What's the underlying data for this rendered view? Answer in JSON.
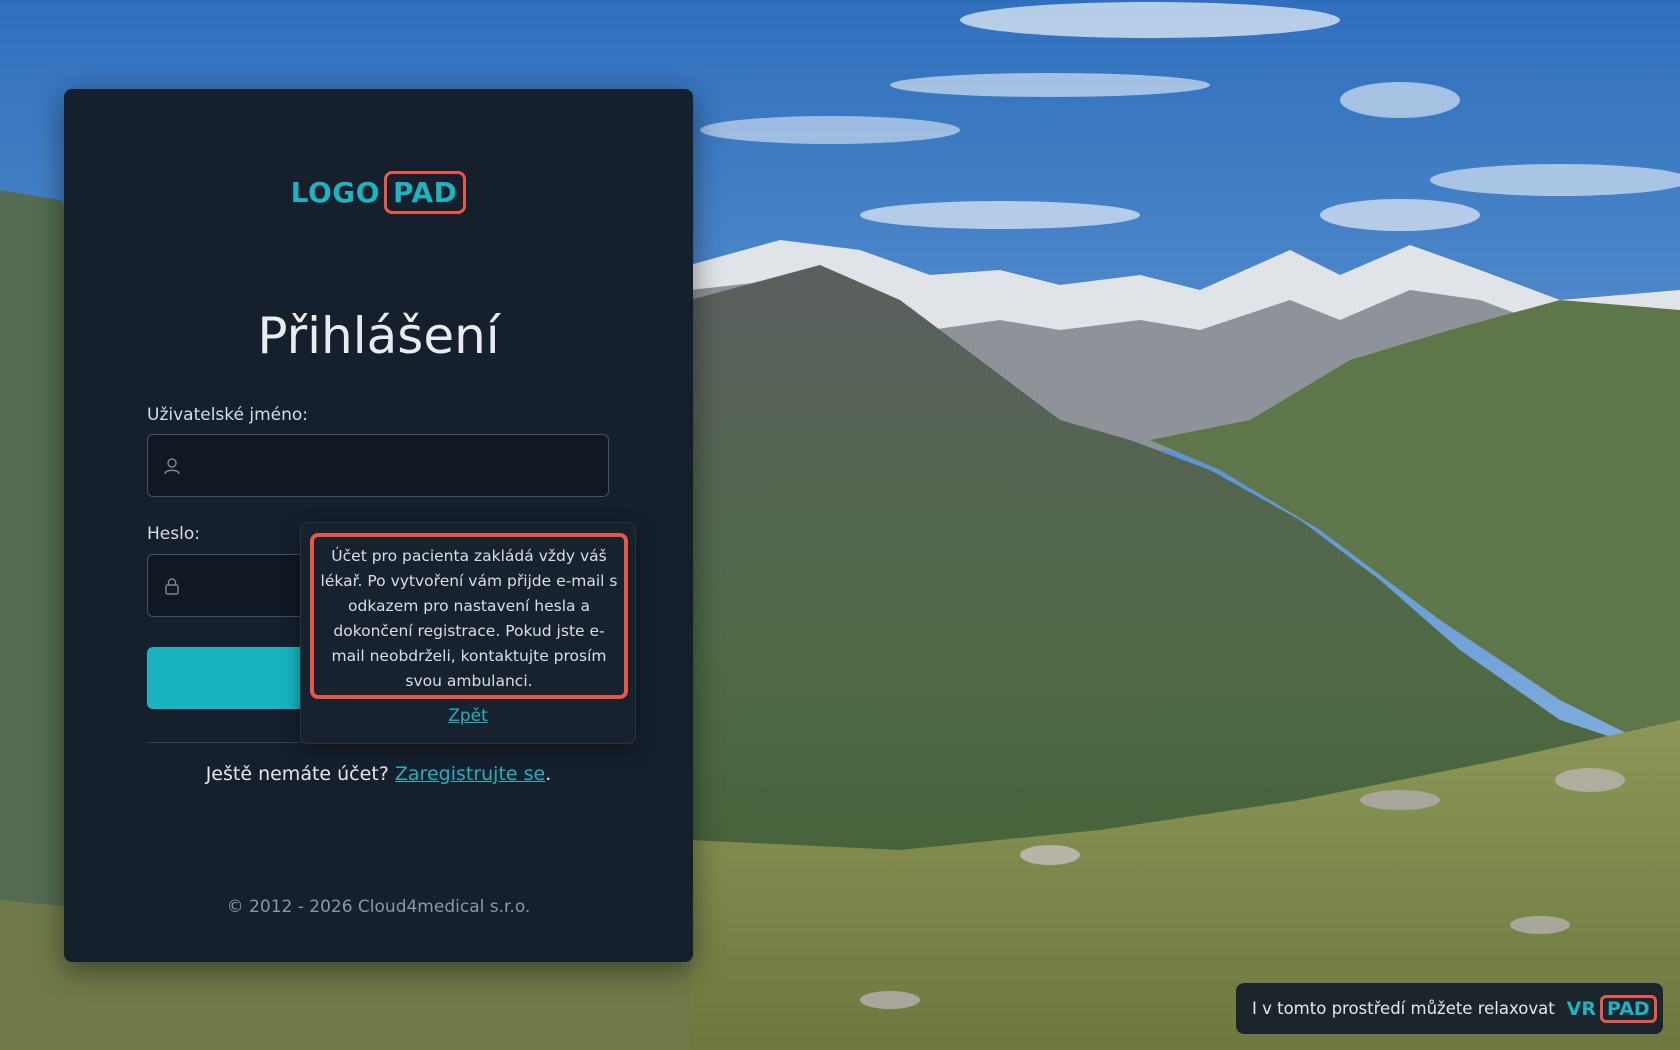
{
  "logo": {
    "part1": "LOGO",
    "part2": "PAD"
  },
  "login": {
    "title": "Přihlášení",
    "username_label": "Uživatelské jméno:",
    "username_value": "",
    "username_placeholder": "",
    "password_label": "Heslo:",
    "password_value": "",
    "password_placeholder": "",
    "submit_label": ""
  },
  "register": {
    "prompt": "Ještě nemáte účet? ",
    "link": "Zaregistrujte se",
    "suffix": "."
  },
  "popover": {
    "text": "Účet pro pacienta zakládá vždy váš lékař. Po vytvoření vám přijde e-mail s odkazem pro nastavení hesla a dokončení registrace. Pokud jste e-mail neobdrželi, kontaktujte prosím svou ambulanci.",
    "back_link": "Zpět"
  },
  "footer": {
    "copyright": "© 2012 - 2026 Cloud4medical s.r.o."
  },
  "vr_banner": {
    "text": "I v tomto prostředí můžete relaxovat",
    "logo_part1": "VR",
    "logo_part2": "PAD"
  },
  "colors": {
    "accent": "#1fb3bf",
    "highlight": "#e8574c",
    "card_bg": "#16202d"
  },
  "icons": {
    "username": "user-icon",
    "password": "lock-icon"
  }
}
